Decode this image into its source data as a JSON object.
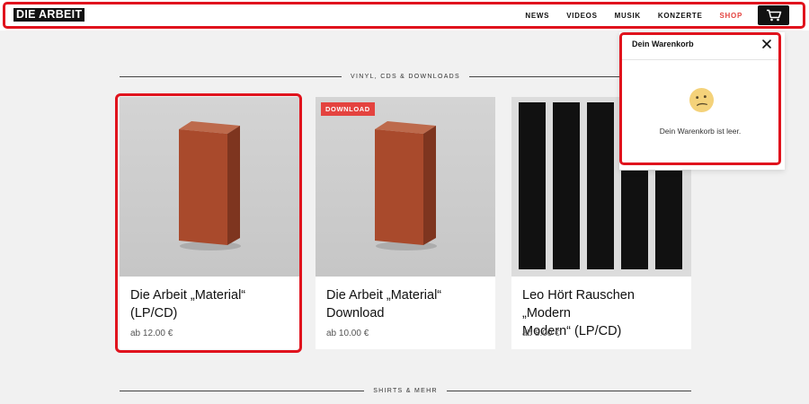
{
  "header": {
    "logo": "DIE ARBEIT",
    "nav": [
      "NEWS",
      "VIDEOS",
      "MUSIK",
      "KONZERTE",
      "SHOP"
    ]
  },
  "sections": {
    "vinyl": "VINYL, CDS & DOWNLOADS",
    "shirts": "SHIRTS & MEHR"
  },
  "products": [
    {
      "title_line1": "Die Arbeit „Material“",
      "title_line2": "(LP/CD)",
      "price": "ab 12.00 €"
    },
    {
      "title_line1": "Die Arbeit „Material“",
      "title_line2": "Download",
      "price": "ab 10.00 €",
      "badge": "DOWNLOAD"
    },
    {
      "title_line1": "Leo Hört Rauschen „Modern",
      "title_line2": "Modern“ (LP/CD)",
      "price": "ab 8.00 €"
    }
  ],
  "cart": {
    "title": "Dein Warenkorb",
    "empty_message": "Dein Warenkorb ist leer."
  },
  "colors": {
    "accent": "#e4433f",
    "highlight": "#e0131d",
    "brick": "#a94a2c"
  }
}
